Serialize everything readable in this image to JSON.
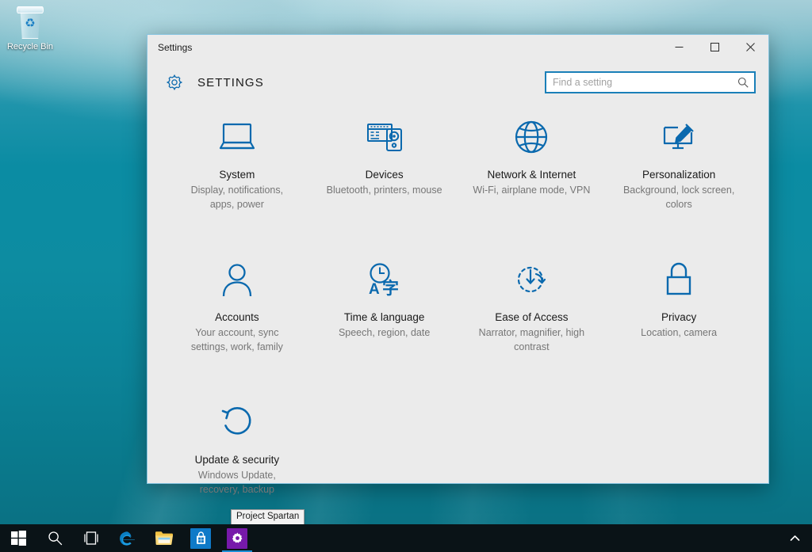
{
  "desktop": {
    "icons": [
      {
        "name": "recycle-bin",
        "label": "Recycle Bin"
      }
    ]
  },
  "window": {
    "titlebar_text": "Settings",
    "controls": {
      "minimize": "Minimize",
      "maximize": "Maximize",
      "close": "Close"
    },
    "header": {
      "icon": "gear-icon",
      "title": "SETTINGS"
    },
    "search": {
      "placeholder": "Find a setting",
      "value": "",
      "icon": "search-icon"
    },
    "tiles": [
      {
        "icon": "laptop-icon",
        "title": "System",
        "desc": "Display, notifications, apps, power"
      },
      {
        "icon": "devices-icon",
        "title": "Devices",
        "desc": "Bluetooth, printers, mouse"
      },
      {
        "icon": "globe-icon",
        "title": "Network & Internet",
        "desc": "Wi-Fi, airplane mode, VPN"
      },
      {
        "icon": "monitor-paintbrush-icon",
        "title": "Personalization",
        "desc": "Background, lock screen, colors"
      },
      {
        "icon": "person-icon",
        "title": "Accounts",
        "desc": "Your account, sync settings, work, family"
      },
      {
        "icon": "clock-language-icon",
        "title": "Time & language",
        "desc": "Speech, region, date"
      },
      {
        "icon": "ease-of-access-icon",
        "title": "Ease of Access",
        "desc": "Narrator, magnifier, high contrast"
      },
      {
        "icon": "padlock-icon",
        "title": "Privacy",
        "desc": "Location, camera"
      },
      {
        "icon": "refresh-icon",
        "title": "Update & security",
        "desc": "Windows Update, recovery, backup"
      }
    ]
  },
  "tooltip": {
    "text": "Project Spartan"
  },
  "taskbar": {
    "items": [
      {
        "name": "start-button",
        "icon": "windows-logo-icon",
        "label": "Start",
        "active": false
      },
      {
        "name": "search-button",
        "icon": "search-icon",
        "label": "Search",
        "active": false
      },
      {
        "name": "task-view-button",
        "icon": "task-view-icon",
        "label": "Task View",
        "active": false
      },
      {
        "name": "edge-button",
        "icon": "edge-icon",
        "label": "Microsoft Edge",
        "active": false
      },
      {
        "name": "file-explorer-button",
        "icon": "folder-icon",
        "label": "File Explorer",
        "active": false
      },
      {
        "name": "store-button",
        "icon": "store-bag-icon",
        "label": "Store",
        "active": false
      },
      {
        "name": "settings-taskbar-button",
        "icon": "gear-icon",
        "label": "Settings",
        "active": true
      }
    ],
    "tray": {
      "chevron": "show-hidden-icons",
      "chevron_label": "Show hidden icons"
    }
  },
  "colors": {
    "accent_blue": "#0a69ae",
    "search_border": "#1a7fb8",
    "window_bg": "#ebebeb",
    "title_text": "#1a1a1a",
    "desc_text": "#767676",
    "taskbar_bg": "#0a1317",
    "store_tile": "#0f7ac8",
    "settings_tile": "#7719aa",
    "active_underline": "#1b8fd6"
  }
}
